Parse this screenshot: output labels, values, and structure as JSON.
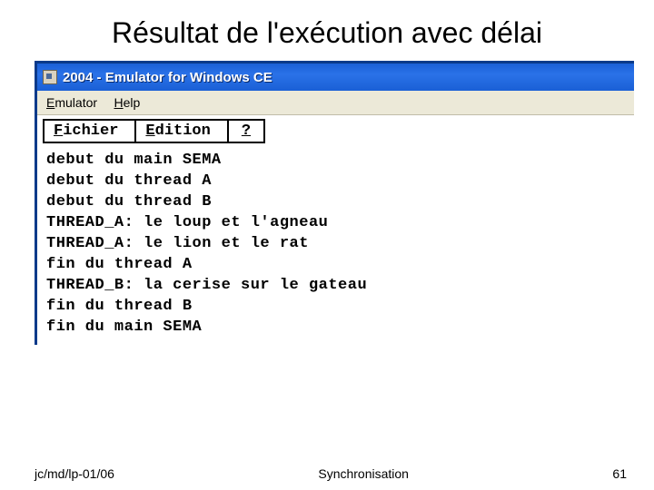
{
  "slide": {
    "title": "Résultat de l'exécution avec délai"
  },
  "window": {
    "title": "2004 - Emulator for Windows CE",
    "outer_menu": {
      "emulator": "Emulator",
      "help": "Help"
    },
    "inner_menu": {
      "fichier_u": "F",
      "fichier_rest": "ichier",
      "edition_u": "E",
      "edition_rest": "dition",
      "question": "?"
    },
    "console_lines": [
      "debut du main SEMA",
      "debut du thread A",
      "debut du thread B",
      "THREAD_A: le loup et l'agneau",
      "THREAD_A: le lion et le rat",
      "fin du thread A",
      "THREAD_B: la cerise sur le gateau",
      "fin du thread B",
      "fin du main SEMA"
    ]
  },
  "footer": {
    "left": "jc/md/lp-01/06",
    "center": "Synchronisation",
    "right": "61"
  }
}
